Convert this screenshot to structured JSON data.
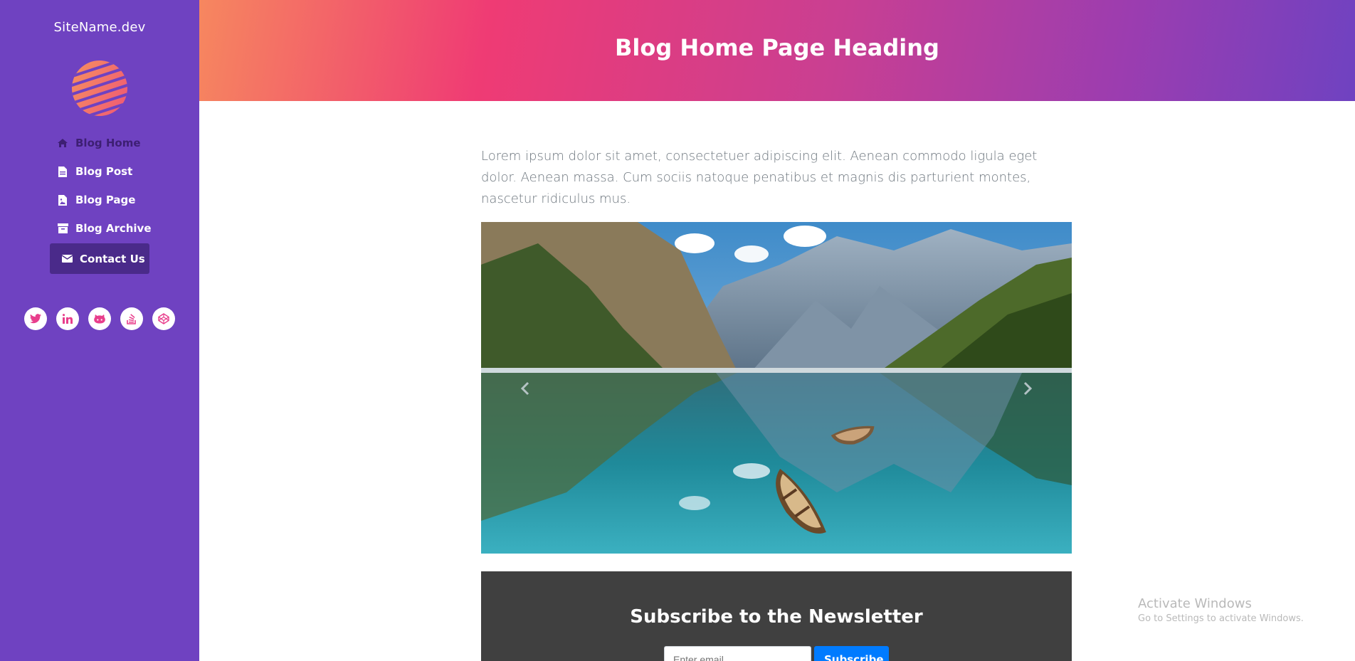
{
  "sidebar": {
    "site_name": "SiteName.dev",
    "logo": "striped-globe-logo",
    "nav": [
      {
        "label": "Blog Home",
        "icon": "home-icon"
      },
      {
        "label": "Blog Post",
        "icon": "file-icon"
      },
      {
        "label": "Blog Page",
        "icon": "file-image-icon"
      },
      {
        "label": "Blog Archive",
        "icon": "archive-icon"
      },
      {
        "label": "Contact Us",
        "icon": "envelope-icon"
      }
    ],
    "socials": [
      "twitter-icon",
      "linkedin-icon",
      "github-icon",
      "stack-overflow-icon",
      "codepen-icon"
    ]
  },
  "header": {
    "title": "Blog Home Page Heading"
  },
  "main": {
    "lead": "Lorem ipsum dolor sit amet, consectetuer adipiscing elit. Aenean commodo ligula eget dolor. Aenean massa. Cum sociis natoque penatibus et magnis dis parturient montes, nascetur ridiculus mus.",
    "carousel": {
      "image": "mountain-lake-with-rowboats",
      "prev_icon": "chevron-left-icon",
      "next_icon": "chevron-right-icon"
    }
  },
  "newsletter": {
    "title": "Subscribe to the Newsletter",
    "input_placeholder": "Enter email...",
    "button_label": "Subscribe"
  },
  "watermark": {
    "title": "Activate Windows",
    "subtitle": "Go to Settings to activate Windows."
  },
  "colors": {
    "sidebar_bg": "#6f42c1",
    "header_gradient_start": "#f6875f",
    "header_gradient_mid": "#ef3b74",
    "header_gradient_end": "#6f42c1",
    "newsletter_bg": "#404040",
    "button_primary": "#007bff",
    "social_icon": "#e83e8c"
  }
}
